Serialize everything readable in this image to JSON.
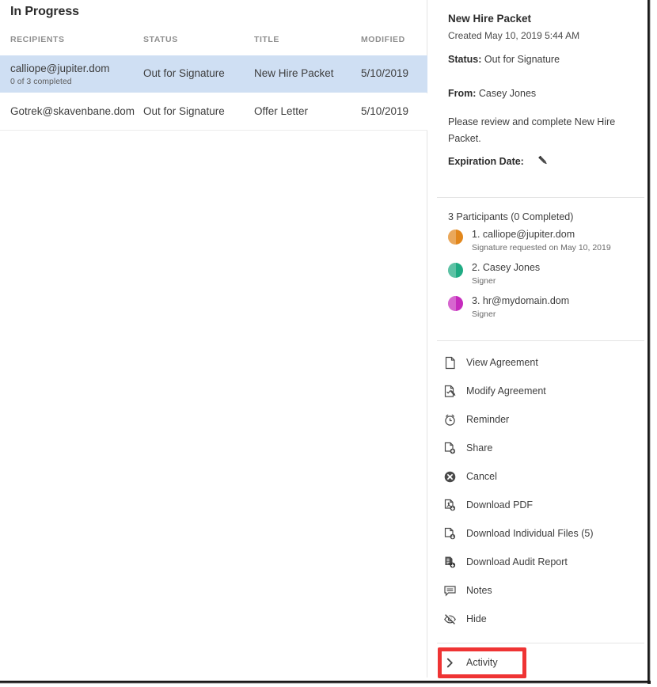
{
  "list": {
    "title": "In Progress",
    "columns": [
      "RECIPIENTS",
      "STATUS",
      "TITLE",
      "MODIFIED"
    ],
    "rows": [
      {
        "recipient": "calliope@jupiter.dom",
        "sub": "0 of 3 completed",
        "status": "Out for Signature",
        "doc_title": "New Hire Packet",
        "modified": "5/10/2019",
        "selected": true
      },
      {
        "recipient": "Gotrek@skavenbane.dom",
        "sub": "",
        "status": "Out for Signature",
        "doc_title": "Offer Letter",
        "modified": "5/10/2019",
        "selected": false
      }
    ]
  },
  "detail": {
    "doc_title": "New Hire Packet",
    "created": "Created May 10, 2019 5:44 AM",
    "status_label": "Status:",
    "status_value": "Out for Signature",
    "from_label": "From:",
    "from_value": "Casey Jones",
    "message": "Please review and complete New Hire Packet.",
    "expiration_label": "Expiration Date:",
    "expiration_edit_icon": "pencil-icon",
    "participants_heading": "3 Participants (0 Completed)",
    "participants": [
      {
        "name": "1. calliope@jupiter.dom",
        "sub": "Signature requested on May 10, 2019",
        "color": "#e2871c"
      },
      {
        "name": "2. Casey Jones",
        "sub": "Signer",
        "color": "#1fab83"
      },
      {
        "name": "3. hr@mydomain.dom",
        "sub": "Signer",
        "color": "#c62bbd"
      }
    ],
    "actions": [
      {
        "label": "View Agreement",
        "icon": "document-icon"
      },
      {
        "label": "Modify Agreement",
        "icon": "document-edit-icon"
      },
      {
        "label": "Reminder",
        "icon": "alarm-clock-icon"
      },
      {
        "label": "Share",
        "icon": "document-add-icon"
      },
      {
        "label": "Cancel",
        "icon": "cancel-circle-icon"
      },
      {
        "label": "Download PDF",
        "icon": "download-pdf-icon"
      },
      {
        "label": "Download Individual Files (5)",
        "icon": "download-files-icon"
      },
      {
        "label": "Download Audit Report",
        "icon": "download-report-icon"
      },
      {
        "label": "Notes",
        "icon": "comment-icon"
      },
      {
        "label": "Hide",
        "icon": "eye-hidden-icon"
      },
      {
        "label": "Activity",
        "icon": "chevron-right-icon"
      }
    ]
  },
  "annotation": {
    "highlight_color": "#ef3434",
    "highlight_target": "Activity"
  }
}
